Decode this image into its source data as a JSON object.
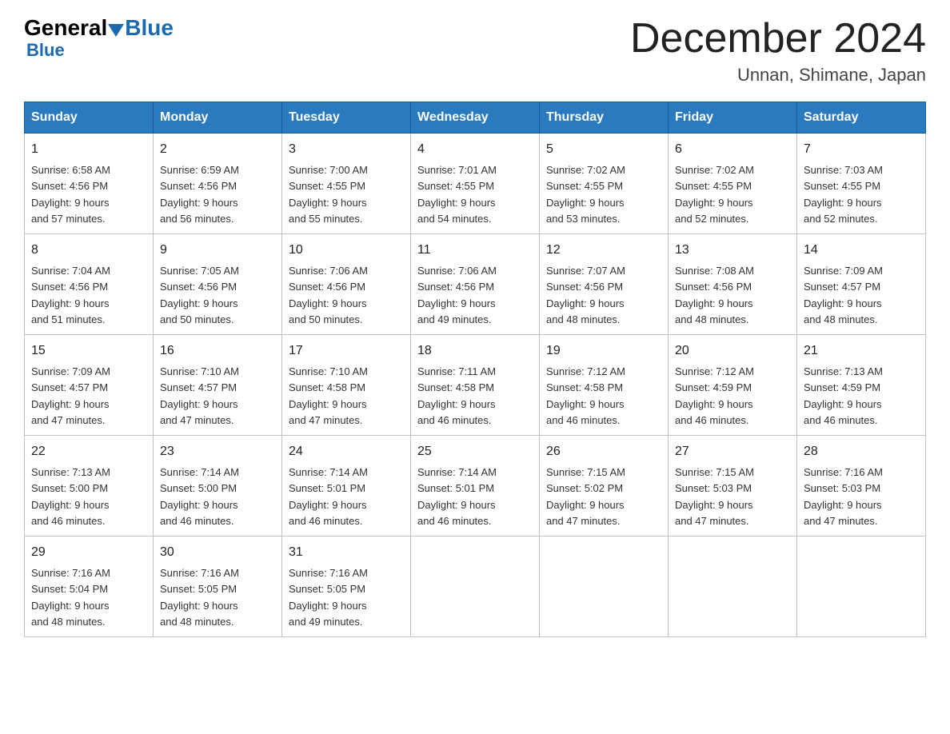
{
  "header": {
    "logo_general": "General",
    "logo_blue": "Blue",
    "month_title": "December 2024",
    "subtitle": "Unnan, Shimane, Japan"
  },
  "days_of_week": [
    "Sunday",
    "Monday",
    "Tuesday",
    "Wednesday",
    "Thursday",
    "Friday",
    "Saturday"
  ],
  "weeks": [
    [
      {
        "day": "1",
        "info": "Sunrise: 6:58 AM\nSunset: 4:56 PM\nDaylight: 9 hours\nand 57 minutes."
      },
      {
        "day": "2",
        "info": "Sunrise: 6:59 AM\nSunset: 4:56 PM\nDaylight: 9 hours\nand 56 minutes."
      },
      {
        "day": "3",
        "info": "Sunrise: 7:00 AM\nSunset: 4:55 PM\nDaylight: 9 hours\nand 55 minutes."
      },
      {
        "day": "4",
        "info": "Sunrise: 7:01 AM\nSunset: 4:55 PM\nDaylight: 9 hours\nand 54 minutes."
      },
      {
        "day": "5",
        "info": "Sunrise: 7:02 AM\nSunset: 4:55 PM\nDaylight: 9 hours\nand 53 minutes."
      },
      {
        "day": "6",
        "info": "Sunrise: 7:02 AM\nSunset: 4:55 PM\nDaylight: 9 hours\nand 52 minutes."
      },
      {
        "day": "7",
        "info": "Sunrise: 7:03 AM\nSunset: 4:55 PM\nDaylight: 9 hours\nand 52 minutes."
      }
    ],
    [
      {
        "day": "8",
        "info": "Sunrise: 7:04 AM\nSunset: 4:56 PM\nDaylight: 9 hours\nand 51 minutes."
      },
      {
        "day": "9",
        "info": "Sunrise: 7:05 AM\nSunset: 4:56 PM\nDaylight: 9 hours\nand 50 minutes."
      },
      {
        "day": "10",
        "info": "Sunrise: 7:06 AM\nSunset: 4:56 PM\nDaylight: 9 hours\nand 50 minutes."
      },
      {
        "day": "11",
        "info": "Sunrise: 7:06 AM\nSunset: 4:56 PM\nDaylight: 9 hours\nand 49 minutes."
      },
      {
        "day": "12",
        "info": "Sunrise: 7:07 AM\nSunset: 4:56 PM\nDaylight: 9 hours\nand 48 minutes."
      },
      {
        "day": "13",
        "info": "Sunrise: 7:08 AM\nSunset: 4:56 PM\nDaylight: 9 hours\nand 48 minutes."
      },
      {
        "day": "14",
        "info": "Sunrise: 7:09 AM\nSunset: 4:57 PM\nDaylight: 9 hours\nand 48 minutes."
      }
    ],
    [
      {
        "day": "15",
        "info": "Sunrise: 7:09 AM\nSunset: 4:57 PM\nDaylight: 9 hours\nand 47 minutes."
      },
      {
        "day": "16",
        "info": "Sunrise: 7:10 AM\nSunset: 4:57 PM\nDaylight: 9 hours\nand 47 minutes."
      },
      {
        "day": "17",
        "info": "Sunrise: 7:10 AM\nSunset: 4:58 PM\nDaylight: 9 hours\nand 47 minutes."
      },
      {
        "day": "18",
        "info": "Sunrise: 7:11 AM\nSunset: 4:58 PM\nDaylight: 9 hours\nand 46 minutes."
      },
      {
        "day": "19",
        "info": "Sunrise: 7:12 AM\nSunset: 4:58 PM\nDaylight: 9 hours\nand 46 minutes."
      },
      {
        "day": "20",
        "info": "Sunrise: 7:12 AM\nSunset: 4:59 PM\nDaylight: 9 hours\nand 46 minutes."
      },
      {
        "day": "21",
        "info": "Sunrise: 7:13 AM\nSunset: 4:59 PM\nDaylight: 9 hours\nand 46 minutes."
      }
    ],
    [
      {
        "day": "22",
        "info": "Sunrise: 7:13 AM\nSunset: 5:00 PM\nDaylight: 9 hours\nand 46 minutes."
      },
      {
        "day": "23",
        "info": "Sunrise: 7:14 AM\nSunset: 5:00 PM\nDaylight: 9 hours\nand 46 minutes."
      },
      {
        "day": "24",
        "info": "Sunrise: 7:14 AM\nSunset: 5:01 PM\nDaylight: 9 hours\nand 46 minutes."
      },
      {
        "day": "25",
        "info": "Sunrise: 7:14 AM\nSunset: 5:01 PM\nDaylight: 9 hours\nand 46 minutes."
      },
      {
        "day": "26",
        "info": "Sunrise: 7:15 AM\nSunset: 5:02 PM\nDaylight: 9 hours\nand 47 minutes."
      },
      {
        "day": "27",
        "info": "Sunrise: 7:15 AM\nSunset: 5:03 PM\nDaylight: 9 hours\nand 47 minutes."
      },
      {
        "day": "28",
        "info": "Sunrise: 7:16 AM\nSunset: 5:03 PM\nDaylight: 9 hours\nand 47 minutes."
      }
    ],
    [
      {
        "day": "29",
        "info": "Sunrise: 7:16 AM\nSunset: 5:04 PM\nDaylight: 9 hours\nand 48 minutes."
      },
      {
        "day": "30",
        "info": "Sunrise: 7:16 AM\nSunset: 5:05 PM\nDaylight: 9 hours\nand 48 minutes."
      },
      {
        "day": "31",
        "info": "Sunrise: 7:16 AM\nSunset: 5:05 PM\nDaylight: 9 hours\nand 49 minutes."
      },
      {
        "day": "",
        "info": ""
      },
      {
        "day": "",
        "info": ""
      },
      {
        "day": "",
        "info": ""
      },
      {
        "day": "",
        "info": ""
      }
    ]
  ]
}
